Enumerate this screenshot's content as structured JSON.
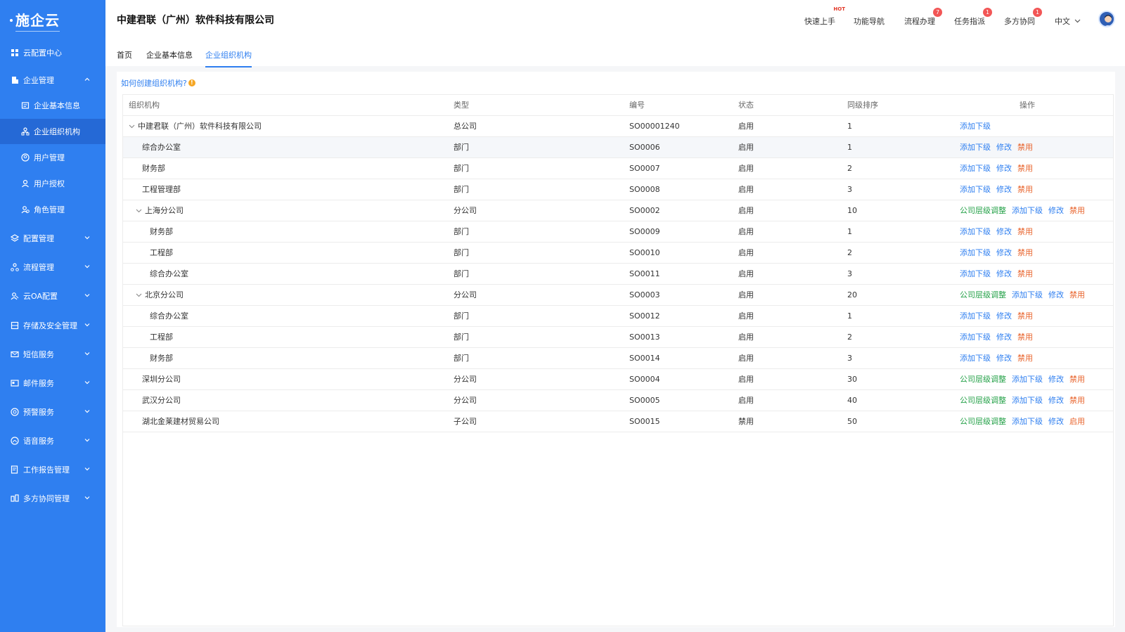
{
  "sidebar": {
    "logo": "施企云",
    "items": [
      {
        "label": "云配置中心",
        "icon": "grid-icon"
      },
      {
        "label": "企业管理",
        "icon": "building-icon"
      },
      {
        "label": "企业基本信息",
        "icon": "id-card-icon"
      },
      {
        "label": "企业组织机构",
        "icon": "org-tree-icon"
      },
      {
        "label": "用户管理",
        "icon": "user-circle-icon"
      },
      {
        "label": "用户授权",
        "icon": "user-icon"
      },
      {
        "label": "角色管理",
        "icon": "user-group-icon"
      },
      {
        "label": "配置管理",
        "icon": "layers-icon"
      },
      {
        "label": "流程管理",
        "icon": "flow-icon"
      },
      {
        "label": "云OA配置",
        "icon": "users-icon"
      },
      {
        "label": "存储及安全管理",
        "icon": "storage-icon"
      },
      {
        "label": "短信服务",
        "icon": "mail-icon"
      },
      {
        "label": "邮件服务",
        "icon": "email-card-icon"
      },
      {
        "label": "预警服务",
        "icon": "alert-icon"
      },
      {
        "label": "语音服务",
        "icon": "voice-icon"
      },
      {
        "label": "工作报告管理",
        "icon": "report-icon"
      },
      {
        "label": "多方协同管理",
        "icon": "collab-icon"
      }
    ]
  },
  "header": {
    "company": "中建君联（广州）软件科技有限公司",
    "nav": [
      {
        "label": "快速上手",
        "hot": "HOT"
      },
      {
        "label": "功能导航"
      },
      {
        "label": "流程办理",
        "badge": "7"
      },
      {
        "label": "任务指派",
        "badge": "1"
      },
      {
        "label": "多方协同",
        "badge": "1"
      }
    ],
    "language": "中文"
  },
  "tabs": [
    {
      "label": "首页"
    },
    {
      "label": "企业基本信息"
    },
    {
      "label": "企业组织机构",
      "active": true
    }
  ],
  "main": {
    "help_link": "如何创建组织机构?",
    "help_dot": "!",
    "columns": [
      "组织机构",
      "类型",
      "编号",
      "状态",
      "同级排序",
      "操作"
    ],
    "rows": [
      {
        "name": "中建君联（广州）软件科技有限公司",
        "type": "总公司",
        "code": "SO00001240",
        "status": "启用",
        "sort": "1",
        "ops": [
          "添加下级"
        ],
        "level": 0,
        "expand": true
      },
      {
        "name": "综合办公室",
        "type": "部门",
        "code": "SO0006",
        "status": "启用",
        "sort": "1",
        "ops": [
          "添加下级",
          "修改",
          "禁用"
        ],
        "level": 1,
        "highlight": true
      },
      {
        "name": "财务部",
        "type": "部门",
        "code": "SO0007",
        "status": "启用",
        "sort": "2",
        "ops": [
          "添加下级",
          "修改",
          "禁用"
        ],
        "level": 1
      },
      {
        "name": "工程管理部",
        "type": "部门",
        "code": "SO0008",
        "status": "启用",
        "sort": "3",
        "ops": [
          "添加下级",
          "修改",
          "禁用"
        ],
        "level": 1
      },
      {
        "name": "上海分公司",
        "type": "分公司",
        "code": "SO0002",
        "status": "启用",
        "sort": "10",
        "ops": [
          "公司层级调整",
          "添加下级",
          "修改",
          "禁用"
        ],
        "level": 1,
        "expand": true
      },
      {
        "name": "财务部",
        "type": "部门",
        "code": "SO0009",
        "status": "启用",
        "sort": "1",
        "ops": [
          "添加下级",
          "修改",
          "禁用"
        ],
        "level": 2
      },
      {
        "name": "工程部",
        "type": "部门",
        "code": "SO0010",
        "status": "启用",
        "sort": "2",
        "ops": [
          "添加下级",
          "修改",
          "禁用"
        ],
        "level": 2
      },
      {
        "name": "综合办公室",
        "type": "部门",
        "code": "SO0011",
        "status": "启用",
        "sort": "3",
        "ops": [
          "添加下级",
          "修改",
          "禁用"
        ],
        "level": 2
      },
      {
        "name": "北京分公司",
        "type": "分公司",
        "code": "SO0003",
        "status": "启用",
        "sort": "20",
        "ops": [
          "公司层级调整",
          "添加下级",
          "修改",
          "禁用"
        ],
        "level": 1,
        "expand": true
      },
      {
        "name": "综合办公室",
        "type": "部门",
        "code": "SO0012",
        "status": "启用",
        "sort": "1",
        "ops": [
          "添加下级",
          "修改",
          "禁用"
        ],
        "level": 2
      },
      {
        "name": "工程部",
        "type": "部门",
        "code": "SO0013",
        "status": "启用",
        "sort": "2",
        "ops": [
          "添加下级",
          "修改",
          "禁用"
        ],
        "level": 2
      },
      {
        "name": "财务部",
        "type": "部门",
        "code": "SO0014",
        "status": "启用",
        "sort": "3",
        "ops": [
          "添加下级",
          "修改",
          "禁用"
        ],
        "level": 2
      },
      {
        "name": "深圳分公司",
        "type": "分公司",
        "code": "SO0004",
        "status": "启用",
        "sort": "30",
        "ops": [
          "公司层级调整",
          "添加下级",
          "修改",
          "禁用"
        ],
        "level": 1
      },
      {
        "name": "武汉分公司",
        "type": "分公司",
        "code": "SO0005",
        "status": "启用",
        "sort": "40",
        "ops": [
          "公司层级调整",
          "添加下级",
          "修改",
          "禁用"
        ],
        "level": 1
      },
      {
        "name": "湖北金莱建材贸易公司",
        "type": "子公司",
        "code": "SO0015",
        "status": "禁用",
        "sort": "50",
        "ops": [
          "公司层级调整",
          "添加下级",
          "修改",
          "启用"
        ],
        "level": 1
      }
    ]
  },
  "colors": {
    "sidebar": "#2f7ff0",
    "active_item": "#2569d6",
    "link": "#2f7ff0",
    "green": "#24a148",
    "red": "#e8622a",
    "badge": "#f25656"
  }
}
